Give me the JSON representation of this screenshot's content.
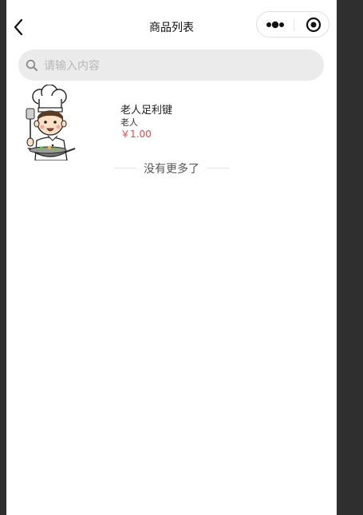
{
  "navbar": {
    "title": "商品列表",
    "back_icon": "chevron-left-icon",
    "capsule": {
      "more_icon": "more-dots-icon",
      "close_icon": "record-circle-icon"
    }
  },
  "search": {
    "placeholder": "请输入内容",
    "value": "",
    "icon": "search-icon"
  },
  "products": [
    {
      "name": "老人足利键",
      "category": "老人",
      "price": "￥1.00",
      "image": "chef-cartoon-image"
    }
  ],
  "footer": {
    "no_more_text": "没有更多了"
  },
  "colors": {
    "price": "#e8464b",
    "search_bg": "#ebebeb",
    "background": "#ffffff",
    "outer": "#2f2f2f"
  }
}
